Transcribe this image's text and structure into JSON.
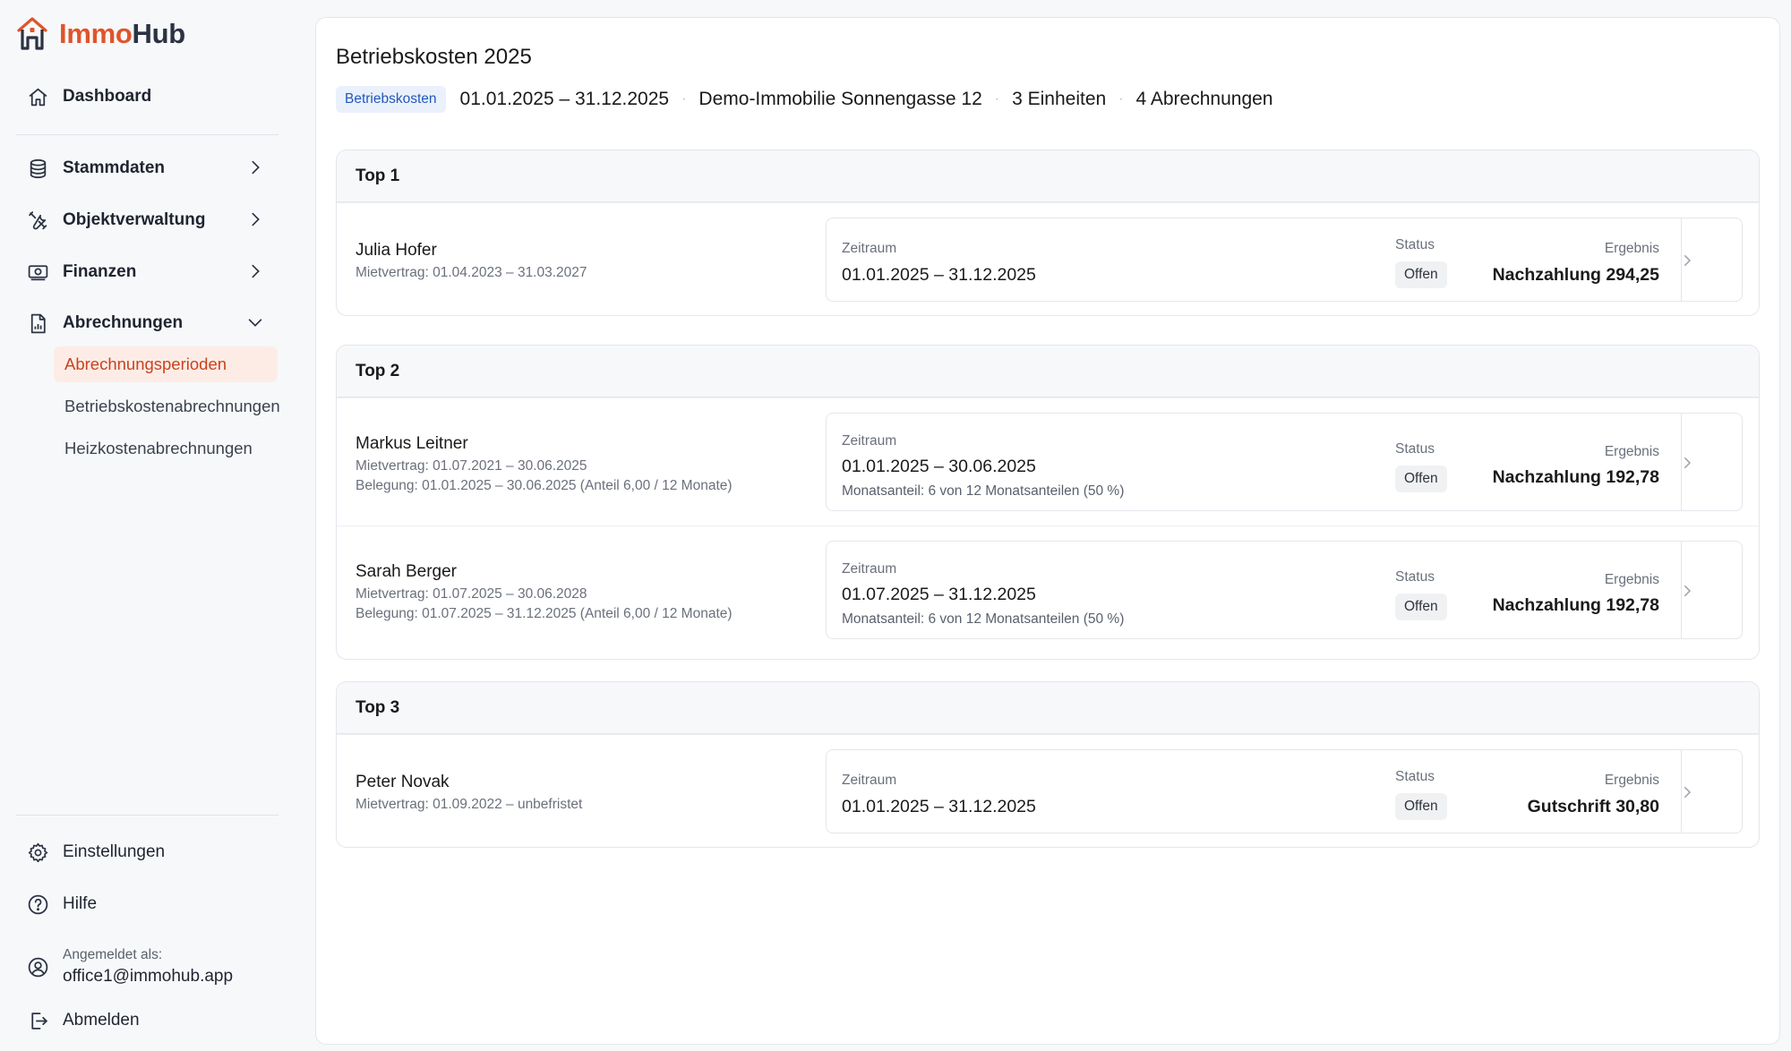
{
  "app": {
    "name_part1": "Immo",
    "name_part2": "Hub",
    "brand_color": "#e0542a",
    "brand_dark": "#2b3242"
  },
  "sidebar": {
    "dashboard": "Dashboard",
    "items": [
      {
        "label": "Stammdaten",
        "icon": "database-icon"
      },
      {
        "label": "Objektverwaltung",
        "icon": "tools-icon"
      },
      {
        "label": "Finanzen",
        "icon": "banknote-icon"
      },
      {
        "label": "Abrechnungen",
        "icon": "document-chart-icon"
      }
    ],
    "sub_items": [
      {
        "label": "Abrechnungsperioden",
        "active": true
      },
      {
        "label": "Betriebskostenabrechnungen",
        "active": false
      },
      {
        "label": "Heizkostenabrechnungen",
        "active": false
      }
    ],
    "settings": "Einstellungen",
    "help": "Hilfe",
    "logged_in_label": "Angemeldet als:",
    "user_email": "office1@immohub.app",
    "logout": "Abmelden"
  },
  "header": {
    "title": "Betriebskosten 2025",
    "chip": "Betriebskosten",
    "period": "01.01.2025 – 31.12.2025",
    "property": "Demo-Immobilie Sonnengasse 12",
    "units": "3 Einheiten",
    "statements": "4 Abrechnungen"
  },
  "labels": {
    "zeitraum": "Zeitraum",
    "status": "Status",
    "ergebnis": "Ergebnis"
  },
  "groups": [
    {
      "title": "Top 1",
      "rows": [
        {
          "name": "Julia Hofer",
          "lease": "Mietvertrag: 01.04.2023 – 31.03.2027",
          "occupancy": "",
          "period": "01.01.2025 – 31.12.2025",
          "share": "",
          "status": "Offen",
          "result": "Nachzahlung 294,25"
        }
      ]
    },
    {
      "title": "Top 2",
      "rows": [
        {
          "name": "Markus Leitner",
          "lease": "Mietvertrag: 01.07.2021 – 30.06.2025",
          "occupancy": "Belegung: 01.01.2025 – 30.06.2025 (Anteil 6,00 / 12 Monate)",
          "period": "01.01.2025 – 30.06.2025",
          "share": "Monatsanteil: 6 von 12 Monatsanteilen (50 %)",
          "status": "Offen",
          "result": "Nachzahlung 192,78"
        },
        {
          "name": "Sarah Berger",
          "lease": "Mietvertrag: 01.07.2025 – 30.06.2028",
          "occupancy": "Belegung: 01.07.2025 – 31.12.2025 (Anteil 6,00 / 12 Monate)",
          "period": "01.07.2025 – 31.12.2025",
          "share": "Monatsanteil: 6 von 12 Monatsanteilen (50 %)",
          "status": "Offen",
          "result": "Nachzahlung 192,78"
        }
      ]
    },
    {
      "title": "Top 3",
      "rows": [
        {
          "name": "Peter Novak",
          "lease": "Mietvertrag: 01.09.2022 – unbefristet",
          "occupancy": "",
          "period": "01.01.2025 – 31.12.2025",
          "share": "",
          "status": "Offen",
          "result": "Gutschrift 30,80"
        }
      ]
    }
  ]
}
